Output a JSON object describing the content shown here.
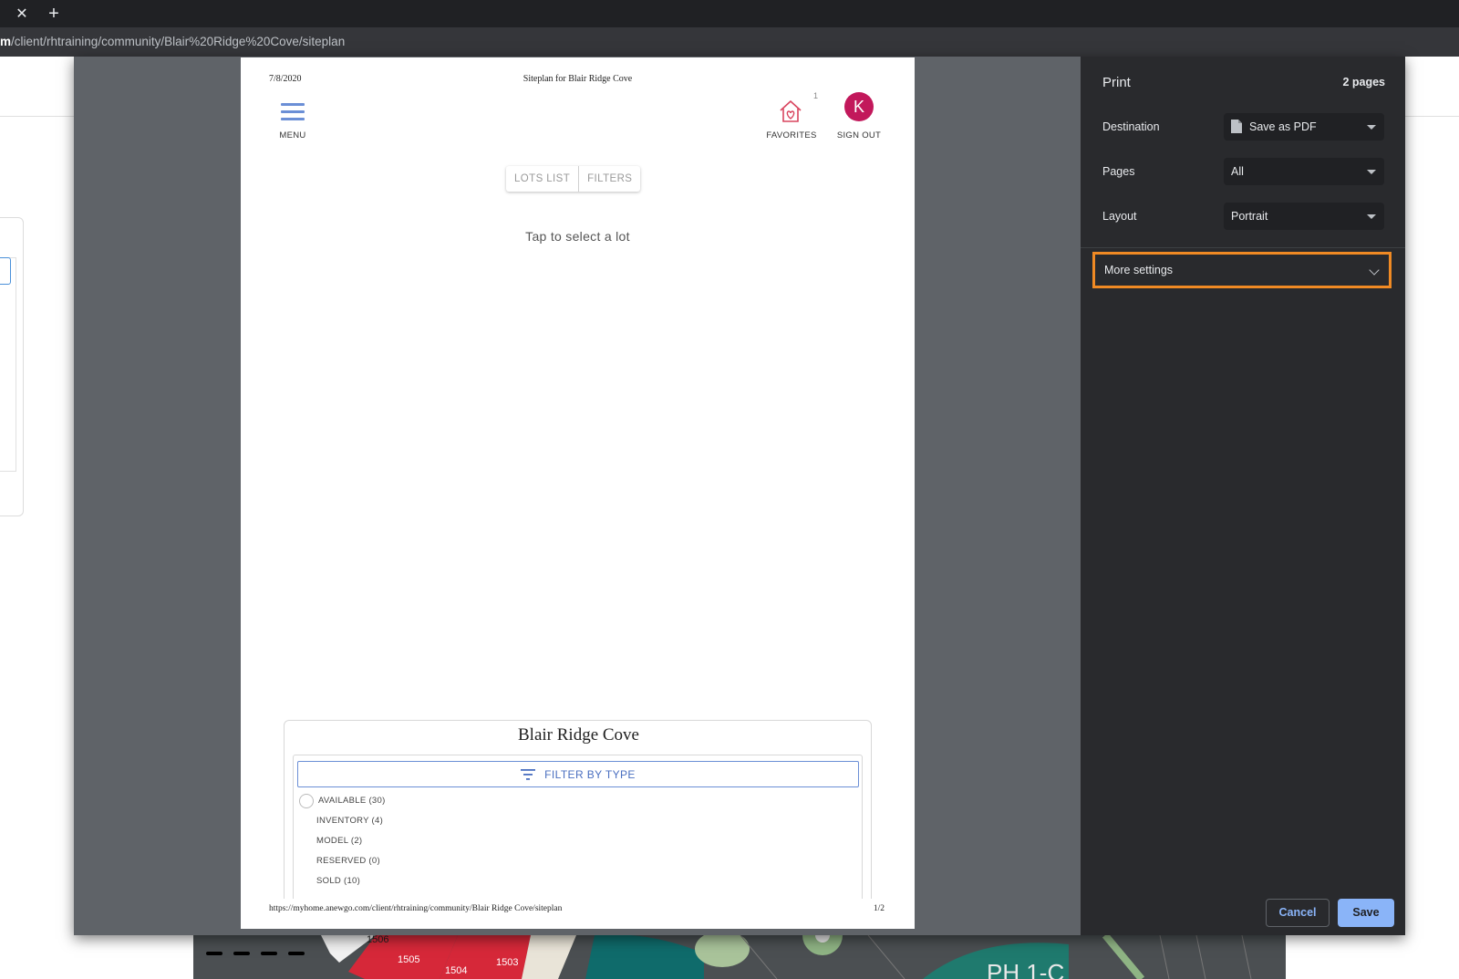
{
  "browser": {
    "tab_close_glyph": "✕",
    "new_tab_glyph": "+",
    "url_host_fragment": "m",
    "url_path": "/client/rhtraining/community/Blair%20Ridge%20Cove/siteplan"
  },
  "preview": {
    "header_date": "7/8/2020",
    "header_title": "Siteplan for Blair Ridge Cove",
    "footer_url": "https://myhome.anewgo.com/client/rhtraining/community/Blair Ridge Cove/siteplan",
    "footer_page": "1/2",
    "menu_label": "MENU",
    "favorites_label": "FAVORITES",
    "favorites_count": "1",
    "avatar_letter": "K",
    "signout_label": "SIGN OUT",
    "tabs": [
      "LOTS LIST",
      "FILTERS"
    ],
    "tap_text": "Tap to select a lot",
    "community_title": "Blair Ridge Cove",
    "filter_button": "FILTER BY TYPE",
    "lot_types": [
      "AVAILABLE (30)",
      "INVENTORY (4)",
      "MODEL (2)",
      "RESERVED (0)",
      "SOLD (10)"
    ]
  },
  "map_lots": [
    "1506",
    "1505",
    "1504",
    "1503"
  ],
  "map_text": "PH 1-C",
  "panel": {
    "title": "Print",
    "page_count": "2 pages",
    "destination_label": "Destination",
    "destination_value": "Save as PDF",
    "pages_label": "Pages",
    "pages_value": "All",
    "layout_label": "Layout",
    "layout_value": "Portrait",
    "more_settings": "More settings",
    "cancel": "Cancel",
    "save": "Save"
  },
  "colors": {
    "highlight": "#f08a24",
    "primary_button": "#8ab4f8",
    "avatar": "#c2185b",
    "accent_blue": "#6b8fd6"
  }
}
